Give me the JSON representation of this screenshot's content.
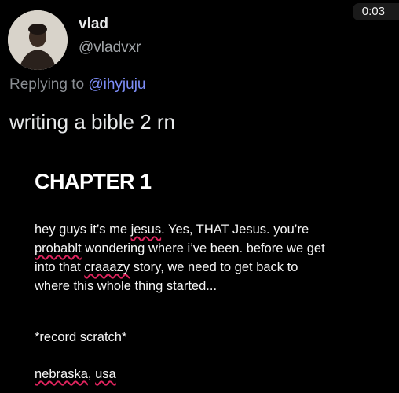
{
  "timer": "0:03",
  "tweet": {
    "display_name": "vlad",
    "handle": "@vladvxr",
    "replying_prefix": "Replying to",
    "replying_mention": "@ihyjuju",
    "text": "writing a bible 2 rn"
  },
  "document": {
    "chapter_title": "CHAPTER 1",
    "line1_a": "hey guys it’s me ",
    "line1_err": "jesus",
    "line1_b": ". Yes, THAT Jesus. you’re",
    "line2_err": "probablt",
    "line2_b": " wondering where i’ve been. before we get",
    "line3_a": "into that ",
    "line3_err": "craaazy",
    "line3_b": " story, we need to get back to",
    "line4": "where this whole thing started...",
    "record_scratch": "*record scratch*",
    "location_err1": "nebraska",
    "location_mid": ", ",
    "location_err2": "usa"
  },
  "colors": {
    "background": "#000000",
    "mention": "#7d8df7",
    "spellcheck": "#e0245e"
  }
}
